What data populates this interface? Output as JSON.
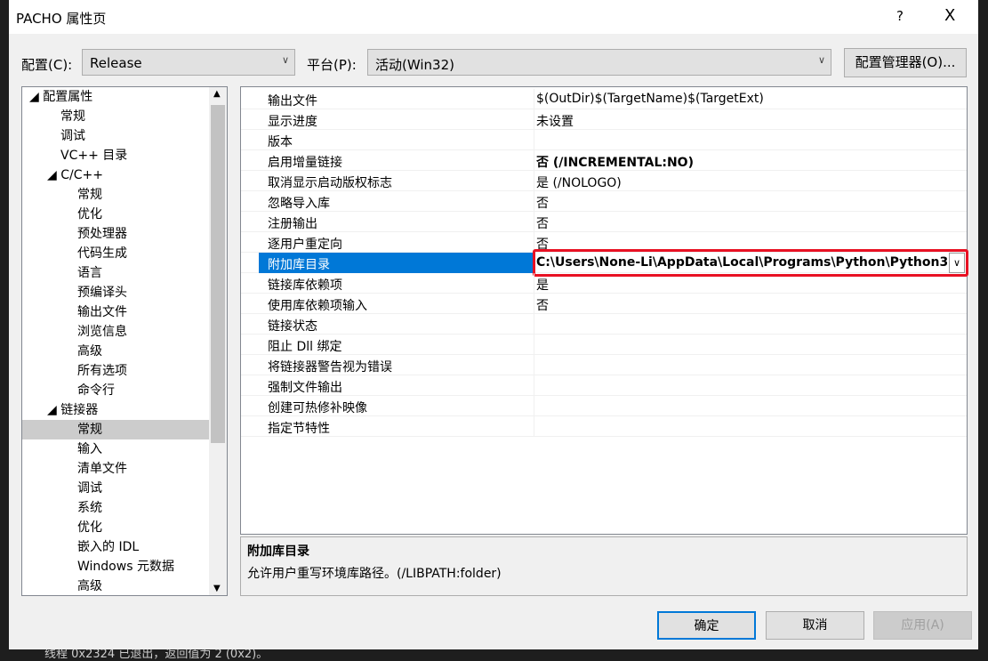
{
  "window": {
    "title": "PACHO 属性页",
    "help": "?",
    "close": "X"
  },
  "config": {
    "label": "配置(C):",
    "value": "Release",
    "platform_label": "平台(P):",
    "platform_value": "活动(Win32)",
    "manager_button": "配置管理器(O)..."
  },
  "tree": [
    {
      "label": "◢ 配置属性",
      "level": 0
    },
    {
      "label": "常规",
      "level": 1
    },
    {
      "label": "调试",
      "level": 1
    },
    {
      "label": "VC++ 目录",
      "level": 1
    },
    {
      "label": "◢ C/C++",
      "level": 1
    },
    {
      "label": "常规",
      "level": 2
    },
    {
      "label": "优化",
      "level": 2
    },
    {
      "label": "预处理器",
      "level": 2
    },
    {
      "label": "代码生成",
      "level": 2
    },
    {
      "label": "语言",
      "level": 2
    },
    {
      "label": "预编译头",
      "level": 2
    },
    {
      "label": "输出文件",
      "level": 2
    },
    {
      "label": "浏览信息",
      "level": 2
    },
    {
      "label": "高级",
      "level": 2
    },
    {
      "label": "所有选项",
      "level": 2
    },
    {
      "label": "命令行",
      "level": 2
    },
    {
      "label": "◢ 链接器",
      "level": 1
    },
    {
      "label": "常规",
      "level": 2,
      "selected": true
    },
    {
      "label": "输入",
      "level": 2
    },
    {
      "label": "清单文件",
      "level": 2
    },
    {
      "label": "调试",
      "level": 2
    },
    {
      "label": "系统",
      "level": 2
    },
    {
      "label": "优化",
      "level": 2
    },
    {
      "label": "嵌入的 IDL",
      "level": 2
    },
    {
      "label": "Windows 元数据",
      "level": 2
    },
    {
      "label": "高级",
      "level": 2
    }
  ],
  "properties": [
    {
      "name": "输出文件",
      "value": "$(OutDir)$(TargetName)$(TargetExt)"
    },
    {
      "name": "显示进度",
      "value": "未设置"
    },
    {
      "name": "版本",
      "value": ""
    },
    {
      "name": "启用增量链接",
      "value": "否 (/INCREMENTAL:NO)",
      "bold": true
    },
    {
      "name": "取消显示启动版权标志",
      "value": "是 (/NOLOGO)"
    },
    {
      "name": "忽略导入库",
      "value": "否"
    },
    {
      "name": "注册输出",
      "value": "否"
    },
    {
      "name": "逐用户重定向",
      "value": "否"
    },
    {
      "name": "附加库目录",
      "value": "C:\\Users\\None-Li\\AppData\\Local\\Programs\\Python\\Python3",
      "bold": true,
      "selected": true
    },
    {
      "name": "链接库依赖项",
      "value": "是"
    },
    {
      "name": "使用库依赖项输入",
      "value": "否"
    },
    {
      "name": "链接状态",
      "value": ""
    },
    {
      "name": "阻止 Dll 绑定",
      "value": ""
    },
    {
      "name": "将链接器警告视为错误",
      "value": ""
    },
    {
      "name": "强制文件输出",
      "value": ""
    },
    {
      "name": "创建可热修补映像",
      "value": ""
    },
    {
      "name": "指定节特性",
      "value": ""
    }
  ],
  "description": {
    "title": "附加库目录",
    "text": "允许用户重写环境库路径。(/LIBPATH:folder)"
  },
  "buttons": {
    "ok": "确定",
    "cancel": "取消",
    "apply": "应用(A)"
  },
  "background_text": "线程 0x2324 已退出，返回值为 2 (0x2)。",
  "colors": {
    "selection": "#0078d7",
    "highlight_border": "#e81123"
  }
}
